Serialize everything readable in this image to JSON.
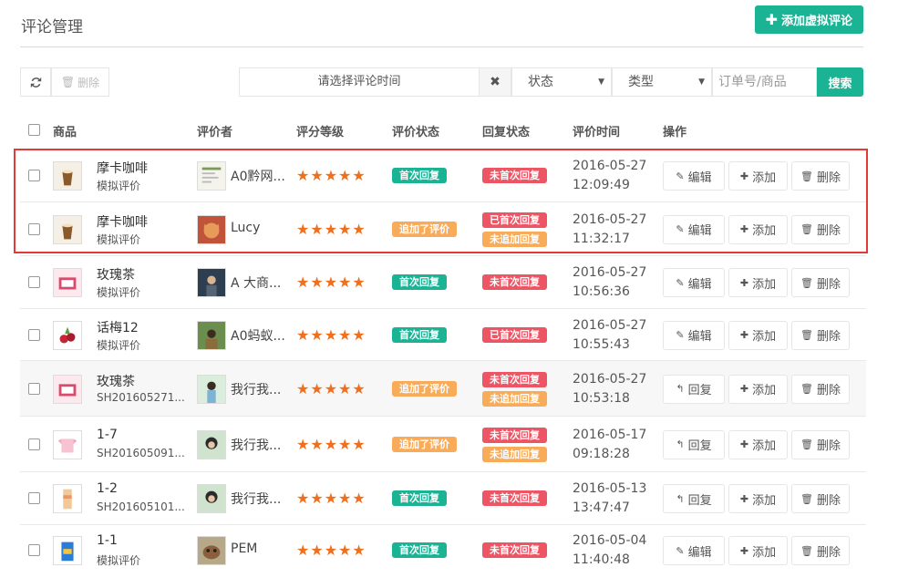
{
  "header": {
    "title": "评论管理",
    "add_button_label": "添加虚拟评论"
  },
  "toolbar": {
    "refresh_icon": "refresh-icon",
    "delete_label": "删除",
    "date_placeholder": "请选择评论时间",
    "clear_symbol": "✖",
    "status_select": "状态",
    "type_select": "类型",
    "search_placeholder": "订单号/商品",
    "search_label": "搜索"
  },
  "table": {
    "headers": [
      "商品",
      "评价者",
      "评分等级",
      "评价状态",
      "回复状态",
      "评价时间",
      "操作"
    ],
    "rows": [
      {
        "product": "摩卡咖啡",
        "sub": "模拟评价",
        "reviewer": "A0黔网...",
        "stars": "★★★★★",
        "status": "首次回复",
        "reply": [
          "未首次回复"
        ],
        "date": "2016-05-27",
        "time": "12:09:49",
        "actions": [
          "编辑",
          "添加",
          "删除"
        ]
      },
      {
        "product": "摩卡咖啡",
        "sub": "模拟评价",
        "reviewer": "Lucy",
        "stars": "★★★★★",
        "status": "追加了评价",
        "reply": [
          "已首次回复",
          "未追加回复"
        ],
        "date": "2016-05-27",
        "time": "11:32:17",
        "actions": [
          "编辑",
          "添加",
          "删除"
        ]
      },
      {
        "product": "玫瑰茶",
        "sub": "模拟评价",
        "reviewer": "A 大商...",
        "stars": "★★★★★",
        "status": "首次回复",
        "reply": [
          "未首次回复"
        ],
        "date": "2016-05-27",
        "time": "10:56:36",
        "actions": [
          "编辑",
          "添加",
          "删除"
        ]
      },
      {
        "product": "话梅12",
        "sub": "模拟评价",
        "reviewer": "A0蚂蚁...",
        "stars": "★★★★★",
        "status": "首次回复",
        "reply": [
          "已首次回复"
        ],
        "date": "2016-05-27",
        "time": "10:55:43",
        "actions": [
          "编辑",
          "添加",
          "删除"
        ]
      },
      {
        "product": "玫瑰茶",
        "sub": "SH201605271...",
        "reviewer": "我行我...",
        "stars": "★★★★★",
        "status": "追加了评价",
        "reply": [
          "未首次回复",
          "未追加回复"
        ],
        "date": "2016-05-27",
        "time": "10:53:18",
        "actions": [
          "回复",
          "添加",
          "删除"
        ]
      },
      {
        "product": "1-7",
        "sub": "SH201605091...",
        "reviewer": "我行我...",
        "stars": "★★★★★",
        "status": "追加了评价",
        "reply": [
          "未首次回复",
          "未追加回复"
        ],
        "date": "2016-05-17",
        "time": "09:18:28",
        "actions": [
          "回复",
          "添加",
          "删除"
        ]
      },
      {
        "product": "1-2",
        "sub": "SH201605101...",
        "reviewer": "我行我...",
        "stars": "★★★★★",
        "status": "首次回复",
        "reply": [
          "未首次回复"
        ],
        "date": "2016-05-13",
        "time": "13:47:47",
        "actions": [
          "回复",
          "添加",
          "删除"
        ]
      },
      {
        "product": "1-1",
        "sub": "模拟评价",
        "reviewer": "PEM",
        "stars": "★★★★★",
        "status": "首次回复",
        "reply": [
          "未首次回复"
        ],
        "date": "2016-05-04",
        "time": "11:40:48",
        "actions": [
          "编辑",
          "添加",
          "删除"
        ]
      }
    ]
  },
  "colors": {
    "accent": "#1ab394",
    "orange": "#f8ac59",
    "red": "#ed5565",
    "star": "#f06f1d",
    "highlight": "#e53935"
  }
}
